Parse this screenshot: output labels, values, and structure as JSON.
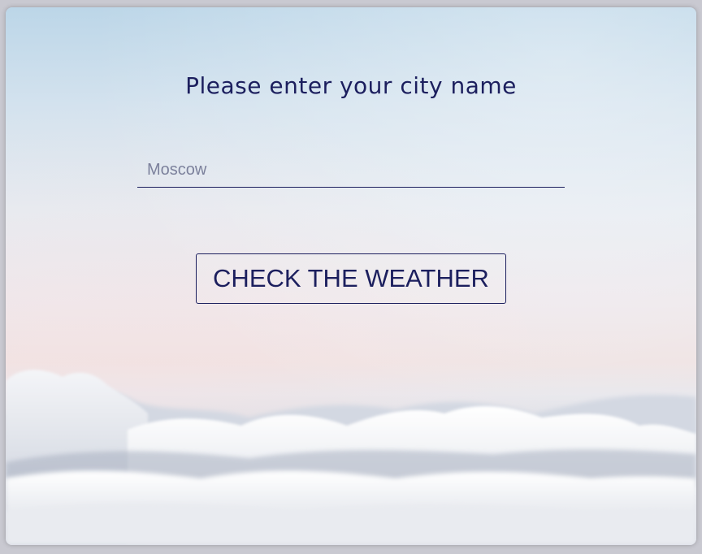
{
  "form": {
    "title": "Please enter your city name",
    "city_input": {
      "value": "",
      "placeholder": "Moscow"
    },
    "submit_label": "CHECK THE WEATHER"
  },
  "colors": {
    "text_primary": "#1c1f5e",
    "placeholder": "#7c819c",
    "sky_top": "#bcd6e8",
    "sky_horizon": "#efe3e3",
    "cloud": "#eceef1"
  }
}
